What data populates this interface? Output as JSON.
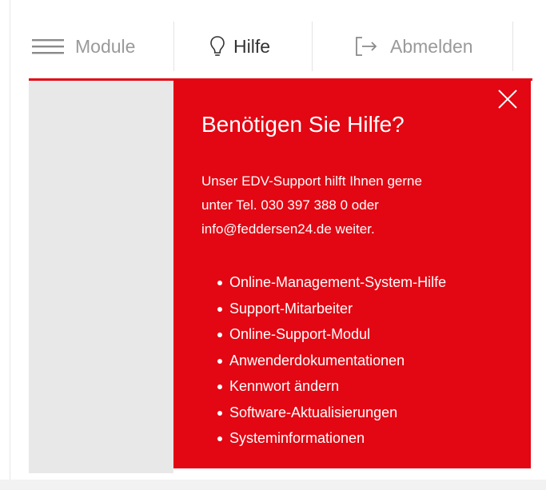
{
  "navbar": {
    "module_label": "Module",
    "help_label": "Hilfe",
    "logout_label": "Abmelden",
    "icons": {
      "module": "hamburger-menu-icon",
      "help": "lightbulb-icon",
      "logout": "logout-arrow-icon"
    }
  },
  "help_panel": {
    "title": "Benötigen Sie Hilfe?",
    "text_lines": [
      "Unser EDV-Support hilft Ihnen gerne",
      "unter Tel. 030 397 388 0 oder",
      "info@feddersen24.de weiter."
    ],
    "links": [
      "Online-Management-System-Hilfe",
      "Support-Mitarbeiter",
      "Online-Support-Modul",
      "Anwenderdokumentationen",
      "Kennwort ändern",
      "Software-Aktualisierungen",
      "Systeminformationen"
    ],
    "close_icon": "close-icon"
  },
  "colors": {
    "accent_red": "#e30613",
    "nav_inactive": "#9a9a9a",
    "nav_active": "#333333",
    "side_gray": "#e8e8e8"
  }
}
